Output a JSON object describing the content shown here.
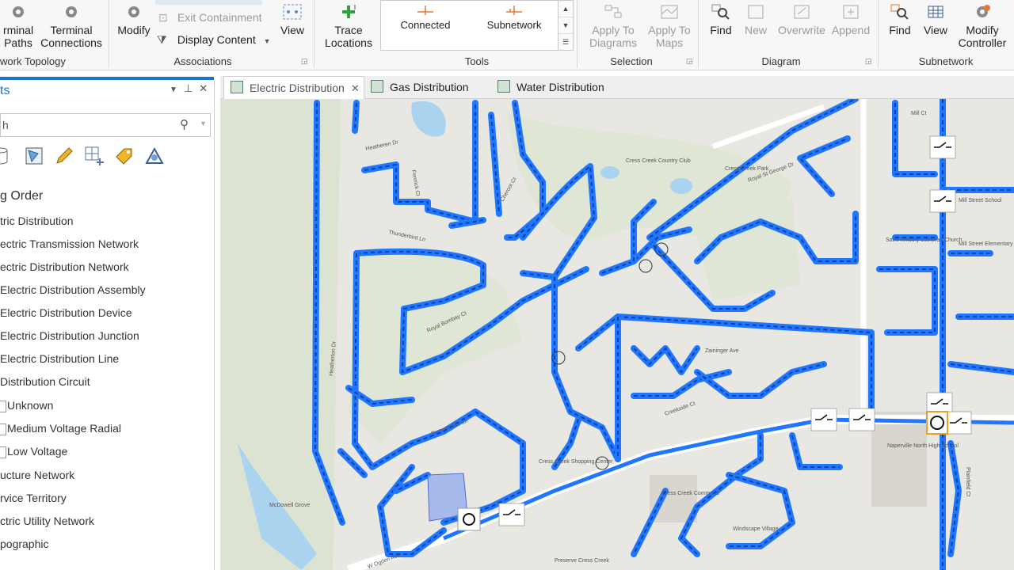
{
  "ribbon": {
    "network_topology": {
      "terminal_paths": "rminal\nPaths",
      "terminal_connections": "Terminal\nConnections",
      "group": "work Topology"
    },
    "associations": {
      "modify": "Modify",
      "exit_containment": "Exit Containment",
      "display_content": "Display Content",
      "view": "View",
      "group": "Associations"
    },
    "tools": {
      "trace_locations": "Trace\nLocations",
      "gallery_connected": "Connected",
      "gallery_subnetwork": "Subnetwork",
      "group": "Tools"
    },
    "selection": {
      "apply_to_diagrams": "Apply To\nDiagrams",
      "apply_to_maps": "Apply To\nMaps",
      "group": "Selection"
    },
    "diagram": {
      "find": "Find",
      "new": "New",
      "overwrite": "Overwrite",
      "append": "Append",
      "group": "Diagram"
    },
    "subnetwork": {
      "find": "Find",
      "view": "View",
      "modify_controller": "Modify\nController",
      "group": "Subnetwork"
    }
  },
  "pane": {
    "title": "ts",
    "search_text": "h",
    "heading": "g Order",
    "layers": [
      {
        "label": "tric Distribution",
        "indent": 0,
        "check": false
      },
      {
        "label": "ectric Transmission Network",
        "indent": 0,
        "check": false
      },
      {
        "label": "ectric Distribution Network",
        "indent": 0,
        "check": false
      },
      {
        "label": "Electric Distribution Assembly",
        "indent": 0,
        "check": false
      },
      {
        "label": "Electric Distribution Device",
        "indent": 0,
        "check": false
      },
      {
        "label": "Electric Distribution Junction",
        "indent": 0,
        "check": false
      },
      {
        "label": "Electric Distribution Line",
        "indent": 0,
        "check": false
      },
      {
        "label": "Distribution Circuit",
        "indent": 0,
        "check": false
      },
      {
        "label": "Unknown",
        "indent": 1,
        "check": true
      },
      {
        "label": "Medium Voltage Radial",
        "indent": 1,
        "check": true
      },
      {
        "label": "Low Voltage",
        "indent": 1,
        "check": true
      },
      {
        "label": "ucture Network",
        "indent": 0,
        "check": false
      },
      {
        "label": "rvice Territory",
        "indent": 0,
        "check": false
      },
      {
        "label": "ctric Utility Network",
        "indent": 0,
        "check": false
      },
      {
        "label": "pographic",
        "indent": 0,
        "check": false
      }
    ]
  },
  "tabs": [
    {
      "label": "Electric Distribution",
      "active": true
    },
    {
      "label": "Gas Distribution",
      "active": false
    },
    {
      "label": "Water Distribution",
      "active": false
    }
  ],
  "map": {
    "labels": [
      "Heatheren Dr",
      "Fennick Ct",
      "Thunderbird Ln",
      "Cheroot Ct",
      "Royal Bombay Ct",
      "Heatherton Dr",
      "Summit Hills Ln",
      "Cress Creek Country Club",
      "Cress Creek Park",
      "Royal St George Dr",
      "Saint Timothy Lutheran Church",
      "Mill Street School",
      "Mill Street Elementary School",
      "Zaininger Ave",
      "Creekside Ct",
      "Naperville North High School",
      "Cress Creek Shopping Center",
      "Cress Creek Commons",
      "Windscape Village",
      "Preserve Cress Creek",
      "McDowell Grove",
      "W Ogden Ave",
      "Plainfield Ct",
      "Mill Ct"
    ],
    "colors": {
      "line": "#1f77ff",
      "dash": "#0b3fa8",
      "base": "#e9e7e2",
      "park": "#dfe6d6",
      "water": "#a9d3ef"
    }
  }
}
